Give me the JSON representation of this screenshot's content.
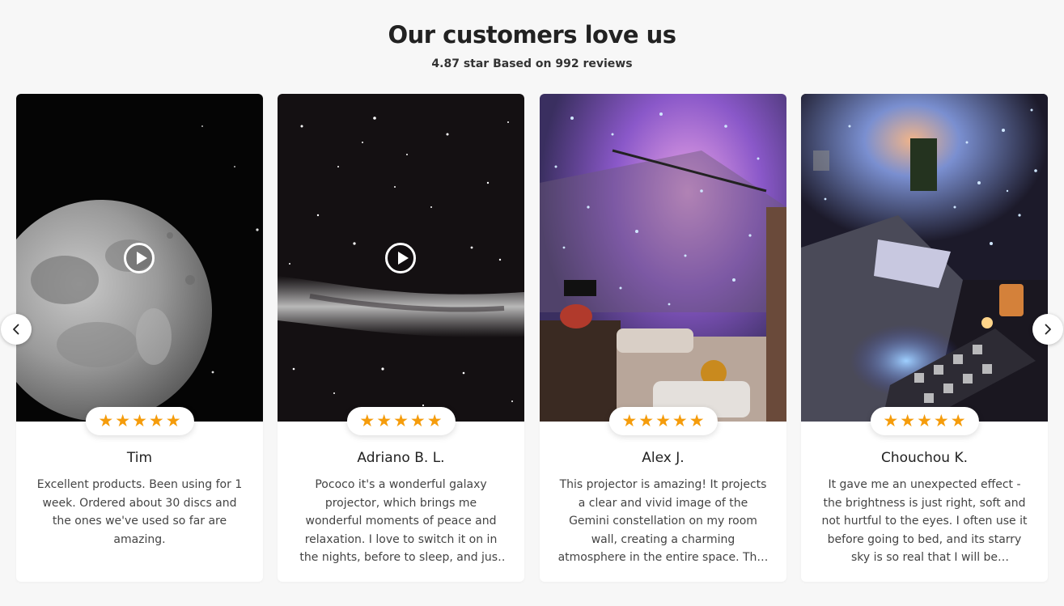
{
  "header": {
    "title": "Our customers love us",
    "subtitle": "4.87 star Based on 992 reviews"
  },
  "colors": {
    "star": "#f59c0b",
    "background": "#f7f7f7"
  },
  "icons": {
    "prev": "chevron-left-icon",
    "next": "chevron-right-icon",
    "play": "play-icon",
    "star": "star-icon"
  },
  "reviews": [
    {
      "name": "Tim",
      "rating": 5,
      "has_video": true,
      "text": "Excellent products. Been using for 1 week. Ordered about 30 discs and the ones we've used so far are amazing."
    },
    {
      "name": "Adriano B. L.",
      "rating": 5,
      "has_video": true,
      "text": "Pococo it's a wonderful galaxy projector, which brings me wonderful moments of peace and relaxation. I love to switch it on in the nights, before to sleep, and just fall asleep…"
    },
    {
      "name": "Alex J.",
      "rating": 5,
      "has_video": false,
      "text": "This projector is amazing! It projects a clear and vivid image of the Gemini constellation on my room wall, creating a charming atmosphere in the entire space. Th…"
    },
    {
      "name": "Chouchou K.",
      "rating": 5,
      "has_video": false,
      "text": "It gave me an unexpected effect - the brightness is just right, soft and not hurtful to the eyes. I often use it before going to bed, and its starry sky is so real that I will be attracted…"
    }
  ]
}
